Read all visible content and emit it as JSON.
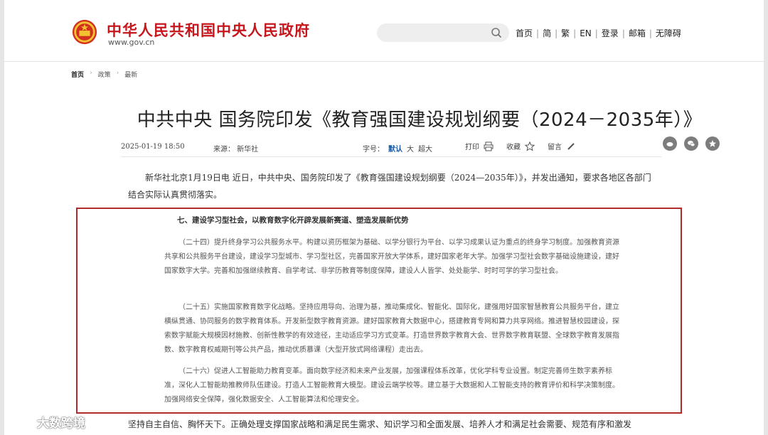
{
  "header": {
    "site_title": "中华人民共和国中央人民政府",
    "site_url": "www.gov.cn",
    "nav": [
      "首页",
      "简",
      "繁",
      "EN",
      "登录",
      "邮箱",
      "无障碍"
    ]
  },
  "breadcrumb": [
    "首页",
    "政策",
    "最新"
  ],
  "article": {
    "title": "中共中央 国务院印发《教育强国建设规划纲要（2024－2035年）》",
    "date": "2025-01-19 18:50",
    "source": "来源：  新华社",
    "font_label": "字号：",
    "font_sizes": [
      "默认",
      "大",
      "超大"
    ],
    "print": "打印",
    "favorite": "收藏",
    "comment": "留言",
    "lead": "新华社北京1月19日电 近日，中共中央、国务院印发了《教育强国建设规划纲要（2024—2035年）》，并发出通知，要求各地区各部门结合实际认真贯彻落实。",
    "excerpt": {
      "heading": "七、建设学习型社会，以教育数字化开辟发展新赛道、塑造发展新优势",
      "paragraphs": [
        "（二十四）提升终身学习公共服务水平。构建以资历框架为基础、以学分银行为平台、以学习成果认证为重点的终身学习制度。加强教育资源共享和公共服务平台建设，建设学习型城市、学习型社区，完善国家开放大学体系，建好国家老年大学。加强学习型社会数字基础设施建设，建好国家数字大学。完善和加强继续教育、自学考试、非学历教育等制度保障，建设人人皆学、处处能学、时时可学的学习型社会。",
        "（二十五）实施国家教育数字化战略。坚持应用导向、治理为基，推动集成化、智能化、国际化，建强用好国家智慧教育公共服务平台，建立横纵贯通、协同服务的数字教育体系。开发新型数字教育资源。建好国家教育大数据中心，搭建教育专网和算力共享网络。推进智慧校园建设，探索数字赋能大规模因材施教、创新性教学的有效途径，主动适应学习方式变革。打造世界数字教育大会、世界数字教育联盟、全球数字教育发展指数、数字教育权威期刊等公共产品，推动优质慕课（大型开放式网络课程）走出去。",
        "（二十六）促进人工智能助力教育变革。面向数字经济和未来产业发展，加强课程体系改革，优化学科专业设置。制定完善师生数字素养标准，深化人工智能助推教师队伍建设。打造人工智能教育大模型。建设云端学校等。建立基于大数据和人工智能支持的教育评价和科学决策制度。加强网络安全保障，强化数据安全、人工智能算法和伦理安全。"
      ]
    },
    "tail": "坚持自主自信、胸怀天下。正确处理支撑国家战略和满足民生需求、知识学习和全面发展、培养人才和满足社会需要、规范有序和激发"
  },
  "watermark": "大数跨境",
  "colors": {
    "brand_red": "#c8161d",
    "highlight_border": "#b22a2a",
    "active_blue": "#1a5aa6"
  }
}
